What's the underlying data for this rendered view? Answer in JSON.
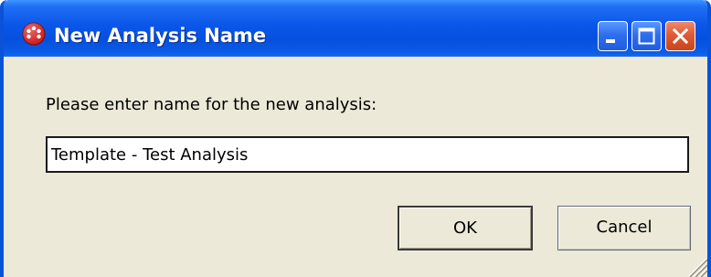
{
  "window": {
    "title": "New Analysis Name",
    "app_icon": "red-dotted-circle-icon",
    "controls": {
      "minimize": "minimize-icon",
      "maximize": "maximize-icon",
      "close": "close-icon"
    }
  },
  "dialog": {
    "prompt": "Please enter name for the new analysis:",
    "name_field": {
      "value": "Template - Test Analysis"
    },
    "ok_label": "OK",
    "cancel_label": "Cancel"
  },
  "colors": {
    "titlebar": "#0a56e8",
    "dialog_background": "#ece9d8",
    "close_button": "#df5a35"
  }
}
